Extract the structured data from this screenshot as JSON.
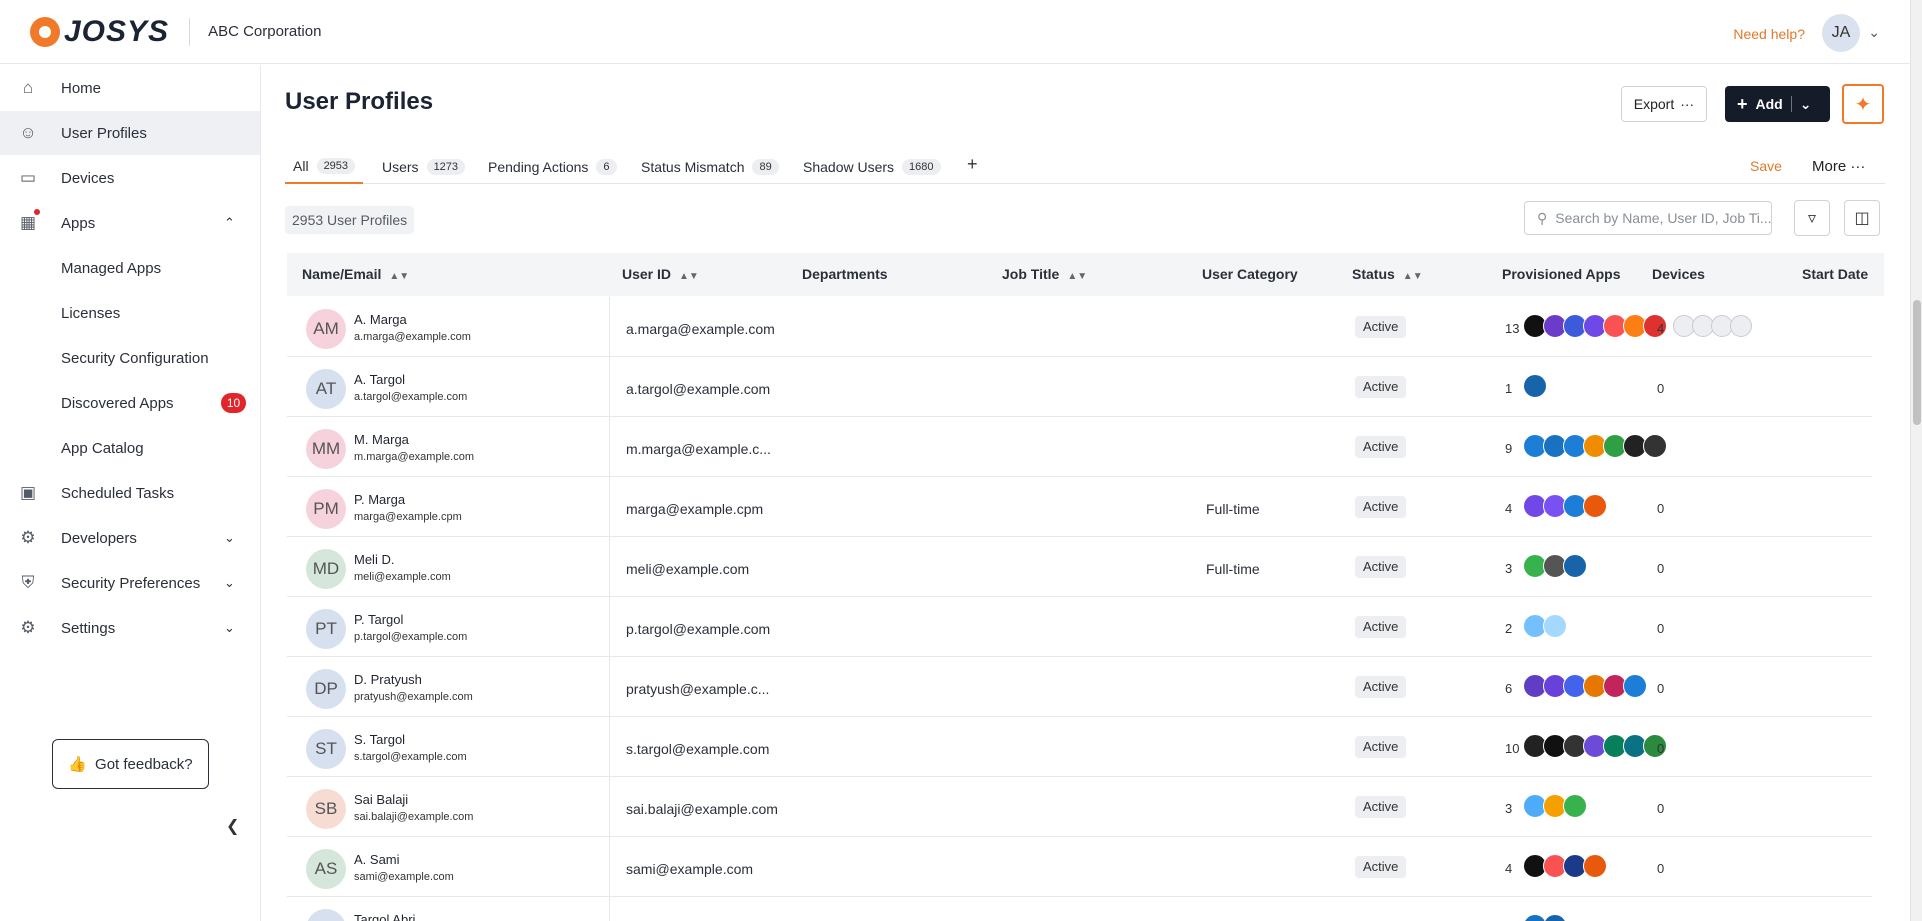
{
  "header": {
    "brand": "JOSYS",
    "org_name": "ABC Corporation",
    "help_label": "Need help?",
    "avatar_initials": "JA"
  },
  "sidebar": {
    "items": [
      {
        "label": "Home",
        "icon": "home-icon"
      },
      {
        "label": "User Profiles",
        "icon": "users-icon"
      },
      {
        "label": "Devices",
        "icon": "laptop-icon"
      },
      {
        "label": "Apps",
        "icon": "grid-icon"
      },
      {
        "label": "Managed Apps"
      },
      {
        "label": "Licenses"
      },
      {
        "label": "Security Configuration"
      },
      {
        "label": "Discovered Apps",
        "badge": "10"
      },
      {
        "label": "App Catalog"
      },
      {
        "label": "Scheduled Tasks",
        "icon": "calendar-icon"
      },
      {
        "label": "Developers",
        "icon": "developer-icon"
      },
      {
        "label": "Security Preferences",
        "icon": "shield-icon"
      },
      {
        "label": "Settings",
        "icon": "gear-icon"
      }
    ],
    "feedback_label": "Got feedback?"
  },
  "page": {
    "title": "User Profiles",
    "export_label": "Export",
    "add_label": "Add"
  },
  "tabs": [
    {
      "label": "All",
      "count": "2953"
    },
    {
      "label": "Users",
      "count": "1273"
    },
    {
      "label": "Pending Actions",
      "count": "6"
    },
    {
      "label": "Status Mismatch",
      "count": "89"
    },
    {
      "label": "Shadow Users",
      "count": "1680"
    }
  ],
  "tab_actions": {
    "save": "Save",
    "more": "More"
  },
  "toolbar": {
    "count_label": "2953 User Profiles",
    "search_placeholder": "Search by Name, User ID, Job Ti..."
  },
  "table": {
    "columns": [
      "Name/Email",
      "User ID",
      "Departments",
      "Job Title",
      "User Category",
      "Status",
      "Provisioned Apps",
      "Devices",
      "Start Date"
    ],
    "rows": [
      {
        "initials": "AM",
        "name": "A. Marga",
        "email": "a.marga@example.com",
        "user_id": "a.marga@example.com",
        "category": "",
        "status": "Active",
        "apps": "13",
        "devices": "4",
        "avatar_color": "#f6d3dc"
      },
      {
        "initials": "AT",
        "name": "A. Targol",
        "email": "a.targol@example.com",
        "user_id": "a.targol@example.com",
        "category": "",
        "status": "Active",
        "apps": "1",
        "devices": "0",
        "avatar_color": "#d6e0ee"
      },
      {
        "initials": "MM",
        "name": "M. Marga",
        "email": "m.marga@example.com",
        "user_id": "m.marga@example.c...",
        "category": "",
        "status": "Active",
        "apps": "9",
        "devices": "0",
        "avatar_color": "#f6d3dc"
      },
      {
        "initials": "PM",
        "name": "P. Marga",
        "email": "marga@example.cpm",
        "user_id": "marga@example.cpm",
        "category": "Full-time",
        "status": "Active",
        "apps": "4",
        "devices": "0",
        "avatar_color": "#f6d3dc"
      },
      {
        "initials": "MD",
        "name": "Meli D.",
        "email": "meli@example.com",
        "user_id": "meli@example.com",
        "category": "Full-time",
        "status": "Active",
        "apps": "3",
        "devices": "0",
        "avatar_color": "#d5e6da"
      },
      {
        "initials": "PT",
        "name": "P. Targol",
        "email": "p.targol@example.com",
        "user_id": "p.targol@example.com",
        "category": "",
        "status": "Active",
        "apps": "2",
        "devices": "0",
        "avatar_color": "#d6e0ee"
      },
      {
        "initials": "DP",
        "name": "D. Pratyush",
        "email": "pratyush@example.com",
        "user_id": "pratyush@example.c...",
        "category": "",
        "status": "Active",
        "apps": "6",
        "devices": "0",
        "avatar_color": "#d6e0ee"
      },
      {
        "initials": "ST",
        "name": "S. Targol",
        "email": "s.targol@example.com",
        "user_id": "s.targol@example.com",
        "category": "",
        "status": "Active",
        "apps": "10",
        "devices": "0",
        "avatar_color": "#d6e0ee"
      },
      {
        "initials": "SB",
        "name": "Sai Balaji",
        "email": "sai.balaji@example.com",
        "user_id": "sai.balaji@example.com",
        "category": "",
        "status": "Active",
        "apps": "3",
        "devices": "0",
        "avatar_color": "#f6dcd3"
      },
      {
        "initials": "AS",
        "name": "A. Sami",
        "email": "sami@example.com",
        "user_id": "sami@example.com",
        "category": "",
        "status": "Active",
        "apps": "4",
        "devices": "0",
        "avatar_color": "#d5e6da"
      },
      {
        "initials": "TA",
        "name": "Targol Abri",
        "email": "",
        "user_id": "",
        "category": "",
        "status": "",
        "apps": "",
        "devices": "",
        "avatar_color": "#d6e0ee"
      }
    ]
  },
  "colors": {
    "accent": "#f07a2a",
    "primary": "#151b28",
    "danger": "#e0252b"
  }
}
